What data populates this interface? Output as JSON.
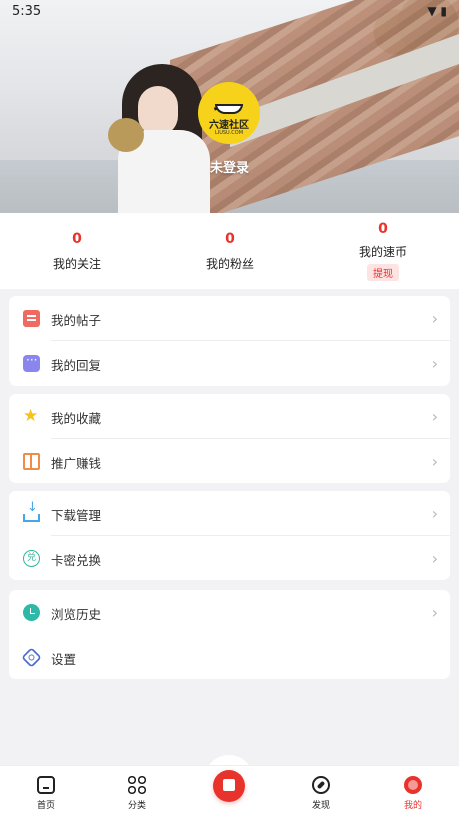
{
  "status_bar": {
    "time": "5:35",
    "icons": "▼ ▮"
  },
  "profile": {
    "avatar_brand": "六速社区",
    "avatar_sub": "LIUSU.COM",
    "login_text": "未登录"
  },
  "stats": [
    {
      "value": "0",
      "label": "我的关注"
    },
    {
      "value": "0",
      "label": "我的粉丝"
    },
    {
      "value": "0",
      "label": "我的速币",
      "action": "提现"
    }
  ],
  "menu": {
    "group1": [
      {
        "label": "我的帖子",
        "icon": "post-icon"
      },
      {
        "label": "我的回复",
        "icon": "reply-icon"
      }
    ],
    "group2": [
      {
        "label": "我的收藏",
        "icon": "star-icon"
      },
      {
        "label": "推广赚钱",
        "icon": "gift-icon"
      }
    ],
    "group3": [
      {
        "label": "下载管理",
        "icon": "download-icon"
      },
      {
        "label": "卡密兑换",
        "icon": "redeem-icon"
      }
    ],
    "group4": [
      {
        "label": "浏览历史",
        "icon": "history-icon"
      },
      {
        "label": "设置",
        "icon": "settings-icon"
      }
    ]
  },
  "nav": {
    "home": "首页",
    "category": "分类",
    "discover": "发现",
    "me": "我的"
  },
  "colors": {
    "accent": "#e8332d"
  }
}
